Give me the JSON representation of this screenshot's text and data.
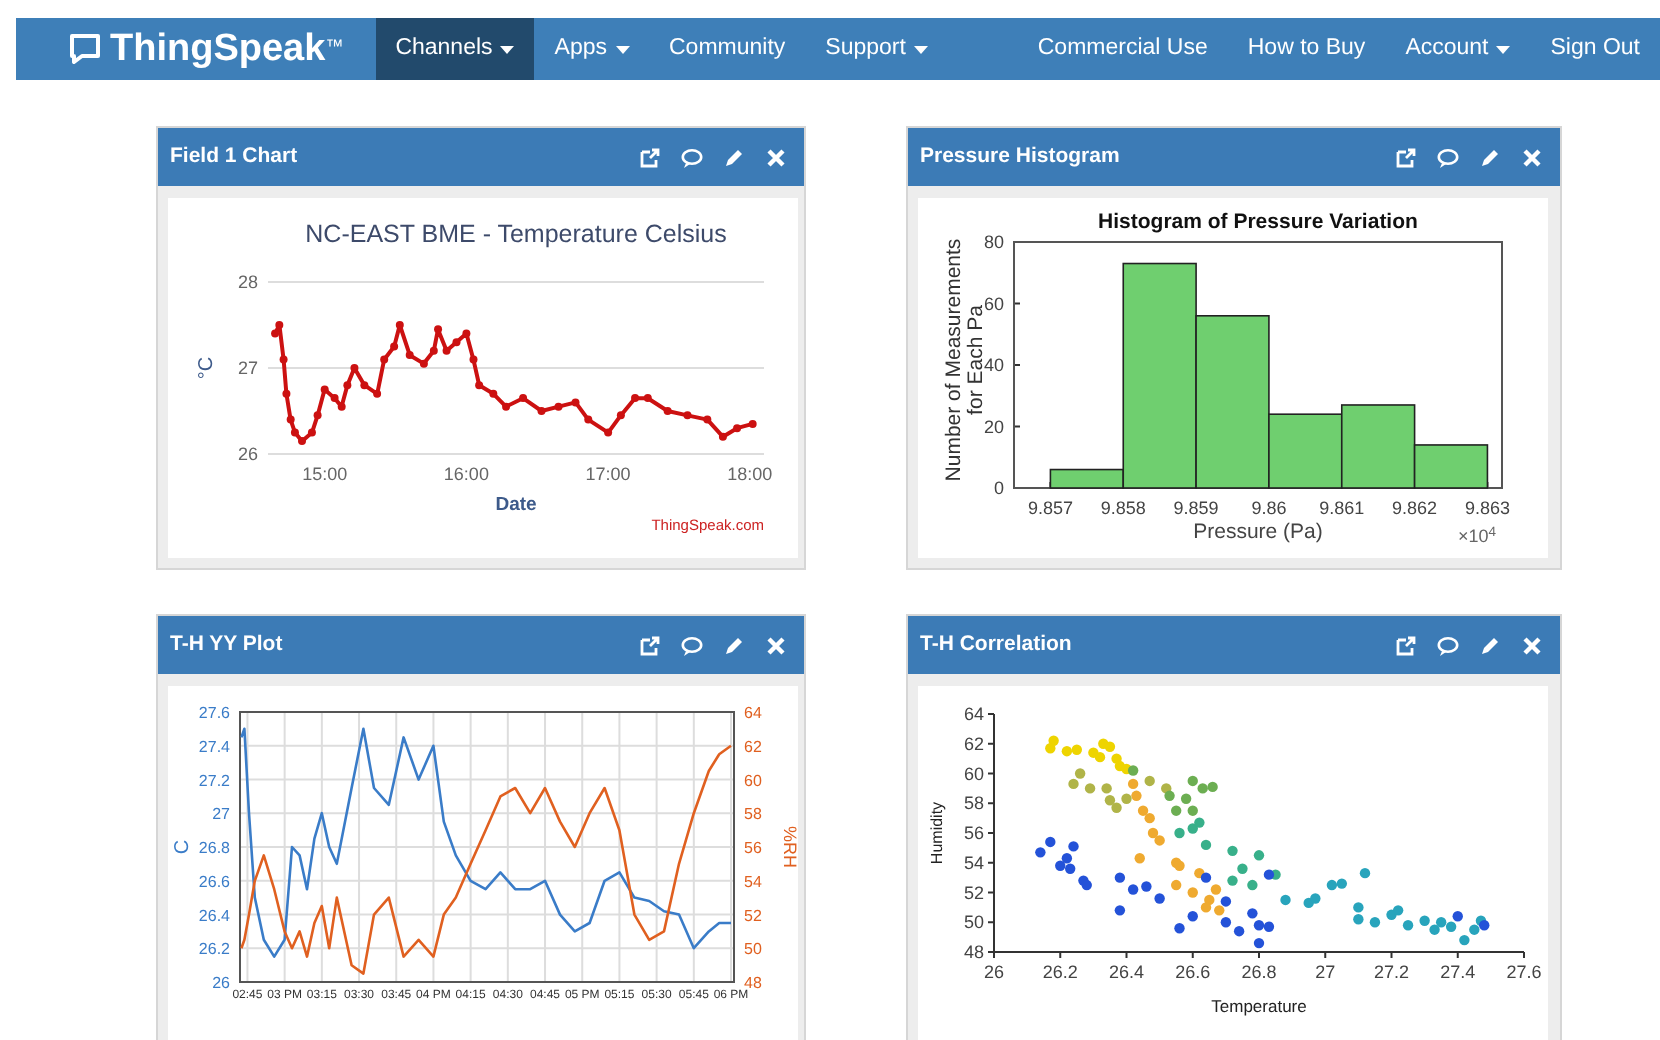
{
  "navbar": {
    "logo": {
      "text": "ThingSpeak",
      "mark": "™"
    },
    "menu_left": [
      {
        "label": "Channels",
        "dropdown": true,
        "selected": true
      },
      {
        "label": "Apps",
        "dropdown": true,
        "selected": false
      },
      {
        "label": "Community",
        "dropdown": false,
        "selected": false
      },
      {
        "label": "Support",
        "dropdown": true,
        "selected": false
      }
    ],
    "menu_right": [
      {
        "label": "Commercial Use",
        "dropdown": false,
        "selected": false
      },
      {
        "label": "How to Buy",
        "dropdown": false,
        "selected": false
      },
      {
        "label": "Account",
        "dropdown": true,
        "selected": false
      },
      {
        "label": "Sign Out",
        "dropdown": false,
        "selected": false
      }
    ]
  },
  "panels": [
    {
      "title": "Field 1 Chart",
      "credit": "ThingSpeak.com",
      "chart_data": {
        "type": "line",
        "title": "NC-EAST BME - Temperature Celsius",
        "xlabel": "Date",
        "ylabel": "°C",
        "grid": true,
        "xlim": [
          14.6,
          18.1
        ],
        "ylim": [
          26,
          28
        ],
        "yticks": [
          26,
          27,
          28
        ],
        "xticks": [
          {
            "value": 15,
            "label": "15:00"
          },
          {
            "value": 16,
            "label": "16:00"
          },
          {
            "value": 17,
            "label": "17:00"
          },
          {
            "value": 18,
            "label": "18:00"
          }
        ],
        "x": [
          14.65,
          14.68,
          14.71,
          14.73,
          14.76,
          14.79,
          14.84,
          14.91,
          14.95,
          15.0,
          15.07,
          15.12,
          15.16,
          15.21,
          15.28,
          15.37,
          15.42,
          15.49,
          15.53,
          15.6,
          15.7,
          15.77,
          15.8,
          15.86,
          15.93,
          16.0,
          16.05,
          16.09,
          16.19,
          16.28,
          16.4,
          16.53,
          16.65,
          16.77,
          16.86,
          17.0,
          17.09,
          17.19,
          17.28,
          17.42,
          17.56,
          17.7,
          17.81,
          17.91,
          18.02
        ],
        "series": [
          {
            "color": "#cc1111",
            "marker": "circle",
            "values": [
              27.4,
              27.5,
              27.1,
              26.7,
              26.4,
              26.25,
              26.15,
              26.25,
              26.45,
              26.75,
              26.65,
              26.55,
              26.8,
              27.0,
              26.8,
              26.7,
              27.1,
              27.25,
              27.5,
              27.15,
              27.05,
              27.2,
              27.45,
              27.2,
              27.3,
              27.4,
              27.1,
              26.8,
              26.7,
              26.55,
              26.65,
              26.5,
              26.55,
              26.6,
              26.4,
              26.25,
              26.45,
              26.65,
              26.65,
              26.5,
              26.45,
              26.4,
              26.2,
              26.3,
              26.35
            ]
          }
        ]
      }
    },
    {
      "title": "Pressure Histogram",
      "chart_data": {
        "type": "bar",
        "title": "Histogram of Pressure Variation",
        "xlabel": "Pressure (Pa)",
        "ylabel": "Number of Measurements for Each Pa",
        "annotations": [
          {
            "text": "×10$^{4}$"
          }
        ],
        "xlim": [
          9.8565,
          9.8632
        ],
        "ylim": [
          0,
          80
        ],
        "yticks": [
          0,
          20,
          40,
          60,
          80
        ],
        "xticks": [
          9.857,
          9.858,
          9.859,
          9.86,
          9.861,
          9.862,
          9.863
        ],
        "x": [
          9.8575,
          9.8585,
          9.8595,
          9.8605,
          9.8615,
          9.8625
        ],
        "series": [
          {
            "color": "#6fcf6f",
            "values": [
              6,
              73,
              56,
              24,
              27,
              14
            ]
          }
        ]
      }
    },
    {
      "title": "T-H YY Plot",
      "chart_data": {
        "type": "line",
        "grid": true,
        "ylabel": "C",
        "y2label": "%RH",
        "xlim": [
          2.7,
          6.02
        ],
        "ylim": [
          26,
          27.6
        ],
        "y2lim": [
          48,
          64
        ],
        "yticks": [
          26,
          26.2,
          26.4,
          26.6,
          26.8,
          27,
          27.2,
          27.4,
          27.6
        ],
        "y2ticks": [
          48,
          50,
          52,
          54,
          56,
          58,
          60,
          62,
          64
        ],
        "xticks": [
          {
            "value": 2.75,
            "label": "02:45"
          },
          {
            "value": 3,
            "label": "03 PM"
          },
          {
            "value": 3.25,
            "label": "03:15"
          },
          {
            "value": 3.5,
            "label": "03:30"
          },
          {
            "value": 3.75,
            "label": "03:45"
          },
          {
            "value": 4,
            "label": "04 PM"
          },
          {
            "value": 4.25,
            "label": "04:15"
          },
          {
            "value": 4.5,
            "label": "04:30"
          },
          {
            "value": 4.75,
            "label": "04:45"
          },
          {
            "value": 5,
            "label": "05 PM"
          },
          {
            "value": 5.25,
            "label": "05:15"
          },
          {
            "value": 5.5,
            "label": "05:30"
          },
          {
            "value": 5.75,
            "label": "05:45"
          },
          {
            "value": 6,
            "label": "06 PM"
          }
        ],
        "x": [
          2.71,
          2.73,
          2.76,
          2.8,
          2.86,
          2.93,
          3.0,
          3.05,
          3.1,
          3.15,
          3.2,
          3.25,
          3.3,
          3.35,
          3.45,
          3.53,
          3.6,
          3.7,
          3.8,
          3.9,
          4.0,
          4.07,
          4.15,
          4.25,
          4.35,
          4.45,
          4.55,
          4.65,
          4.75,
          4.85,
          4.95,
          5.05,
          5.15,
          5.25,
          5.35,
          5.45,
          5.55,
          5.65,
          5.75,
          5.85,
          5.92,
          6.0
        ],
        "series": [
          {
            "color": "#3a7cc8",
            "values": [
              27.45,
              27.5,
              27.0,
              26.5,
              26.25,
              26.15,
              26.25,
              26.8,
              26.75,
              26.55,
              26.85,
              27.0,
              26.8,
              26.7,
              27.15,
              27.5,
              27.15,
              27.05,
              27.45,
              27.2,
              27.4,
              26.95,
              26.75,
              26.6,
              26.55,
              26.65,
              26.55,
              26.55,
              26.6,
              26.4,
              26.3,
              26.35,
              26.6,
              26.65,
              26.5,
              26.48,
              26.42,
              26.4,
              26.2,
              26.3,
              26.35,
              26.35
            ]
          },
          {
            "color": "#e06020",
            "axis": "y2",
            "values": [
              50,
              50.5,
              52,
              54,
              55.5,
              53.5,
              51,
              50,
              51,
              49.5,
              51.5,
              52.5,
              50,
              53,
              49,
              48.5,
              52,
              53,
              49.5,
              50.5,
              49.5,
              52,
              53,
              55,
              57,
              59,
              59.5,
              58,
              59.5,
              57.5,
              56,
              58,
              59.5,
              57,
              52,
              50.5,
              51,
              55,
              58,
              60.5,
              61.5,
              62
            ]
          }
        ]
      }
    },
    {
      "title": "T-H Correlation",
      "chart_data": {
        "type": "scatter",
        "xlabel": "Temperature",
        "ylabel": "Humidity",
        "xlim": [
          26,
          27.6
        ],
        "ylim": [
          48,
          64
        ],
        "xticks": [
          26,
          26.2,
          26.4,
          26.6,
          26.8,
          27,
          27.2,
          27.4,
          27.6
        ],
        "yticks": [
          48,
          50,
          52,
          54,
          56,
          58,
          60,
          62,
          64
        ],
        "series": [
          {
            "color": "#eed400",
            "x": [
              26.18,
              26.17,
              26.22,
              26.25,
              26.3,
              26.33,
              26.35,
              26.37,
              26.38,
              26.4,
              26.32
            ],
            "values": [
              62.2,
              61.7,
              61.5,
              61.6,
              61.4,
              62,
              61.8,
              61,
              60.5,
              60.3,
              61.1
            ]
          },
          {
            "color": "#efaa30",
            "x": [
              26.42,
              26.43,
              26.45,
              26.47,
              26.48,
              26.5,
              26.44,
              26.55,
              26.56,
              26.55,
              26.62,
              26.6,
              26.65,
              26.67,
              26.68,
              26.64
            ],
            "values": [
              59.3,
              58.5,
              57.5,
              57,
              56,
              55.5,
              54.3,
              54,
              53.8,
              52.5,
              53.3,
              52,
              51.5,
              52.2,
              50.8,
              51
            ]
          },
          {
            "color": "#b0b448",
            "x": [
              26.24,
              26.26,
              26.29,
              26.34,
              26.35,
              26.37,
              26.4,
              26.47,
              26.52
            ],
            "values": [
              59.3,
              60,
              59,
              59,
              58.2,
              57.7,
              58.3,
              59.5,
              59
            ]
          },
          {
            "color": "#6cae52",
            "x": [
              26.53,
              26.55,
              26.58,
              26.6,
              26.63,
              26.66,
              26.6,
              26.42
            ],
            "values": [
              58.5,
              57.5,
              58.3,
              59.5,
              59,
              59.1,
              57.5,
              60.2
            ]
          },
          {
            "color": "#38b08a",
            "x": [
              26.56,
              26.6,
              26.62,
              26.64,
              26.72,
              26.75,
              26.8,
              26.78,
              26.72,
              26.85
            ],
            "values": [
              56,
              56.3,
              56.7,
              55.2,
              54.8,
              53.6,
              54.5,
              52.5,
              52.8,
              53.2
            ]
          },
          {
            "color": "#28a4bc",
            "x": [
              26.88,
              26.95,
              26.97,
              27.02,
              27.05,
              27.1,
              27.12,
              27.1,
              27.15,
              27.2,
              27.22,
              27.25,
              27.3,
              27.33,
              27.35,
              27.38,
              27.42,
              27.45,
              27.47
            ],
            "values": [
              51.5,
              51.3,
              51.6,
              52.5,
              52.6,
              51,
              53.3,
              50.2,
              50,
              50.5,
              50.8,
              49.8,
              50.1,
              49.5,
              50,
              49.7,
              48.8,
              49.5,
              50.1
            ]
          },
          {
            "color": "#2452d8",
            "x": [
              26.14,
              26.17,
              26.2,
              26.22,
              26.23,
              26.24,
              26.27,
              26.28,
              26.38,
              26.38,
              26.42,
              26.46,
              26.5,
              26.56,
              26.6,
              26.64,
              26.7,
              26.7,
              26.74,
              26.78,
              26.8,
              26.83,
              26.8,
              26.83,
              27.4,
              27.48
            ],
            "values": [
              54.7,
              55.4,
              53.8,
              54.3,
              53.6,
              55.1,
              52.8,
              52.5,
              53,
              50.8,
              52.2,
              52.4,
              51.6,
              49.6,
              50.4,
              53,
              51.4,
              50,
              49.4,
              50.6,
              49.8,
              49.7,
              48.6,
              53.2,
              50.4,
              49.8
            ]
          }
        ]
      }
    }
  ]
}
